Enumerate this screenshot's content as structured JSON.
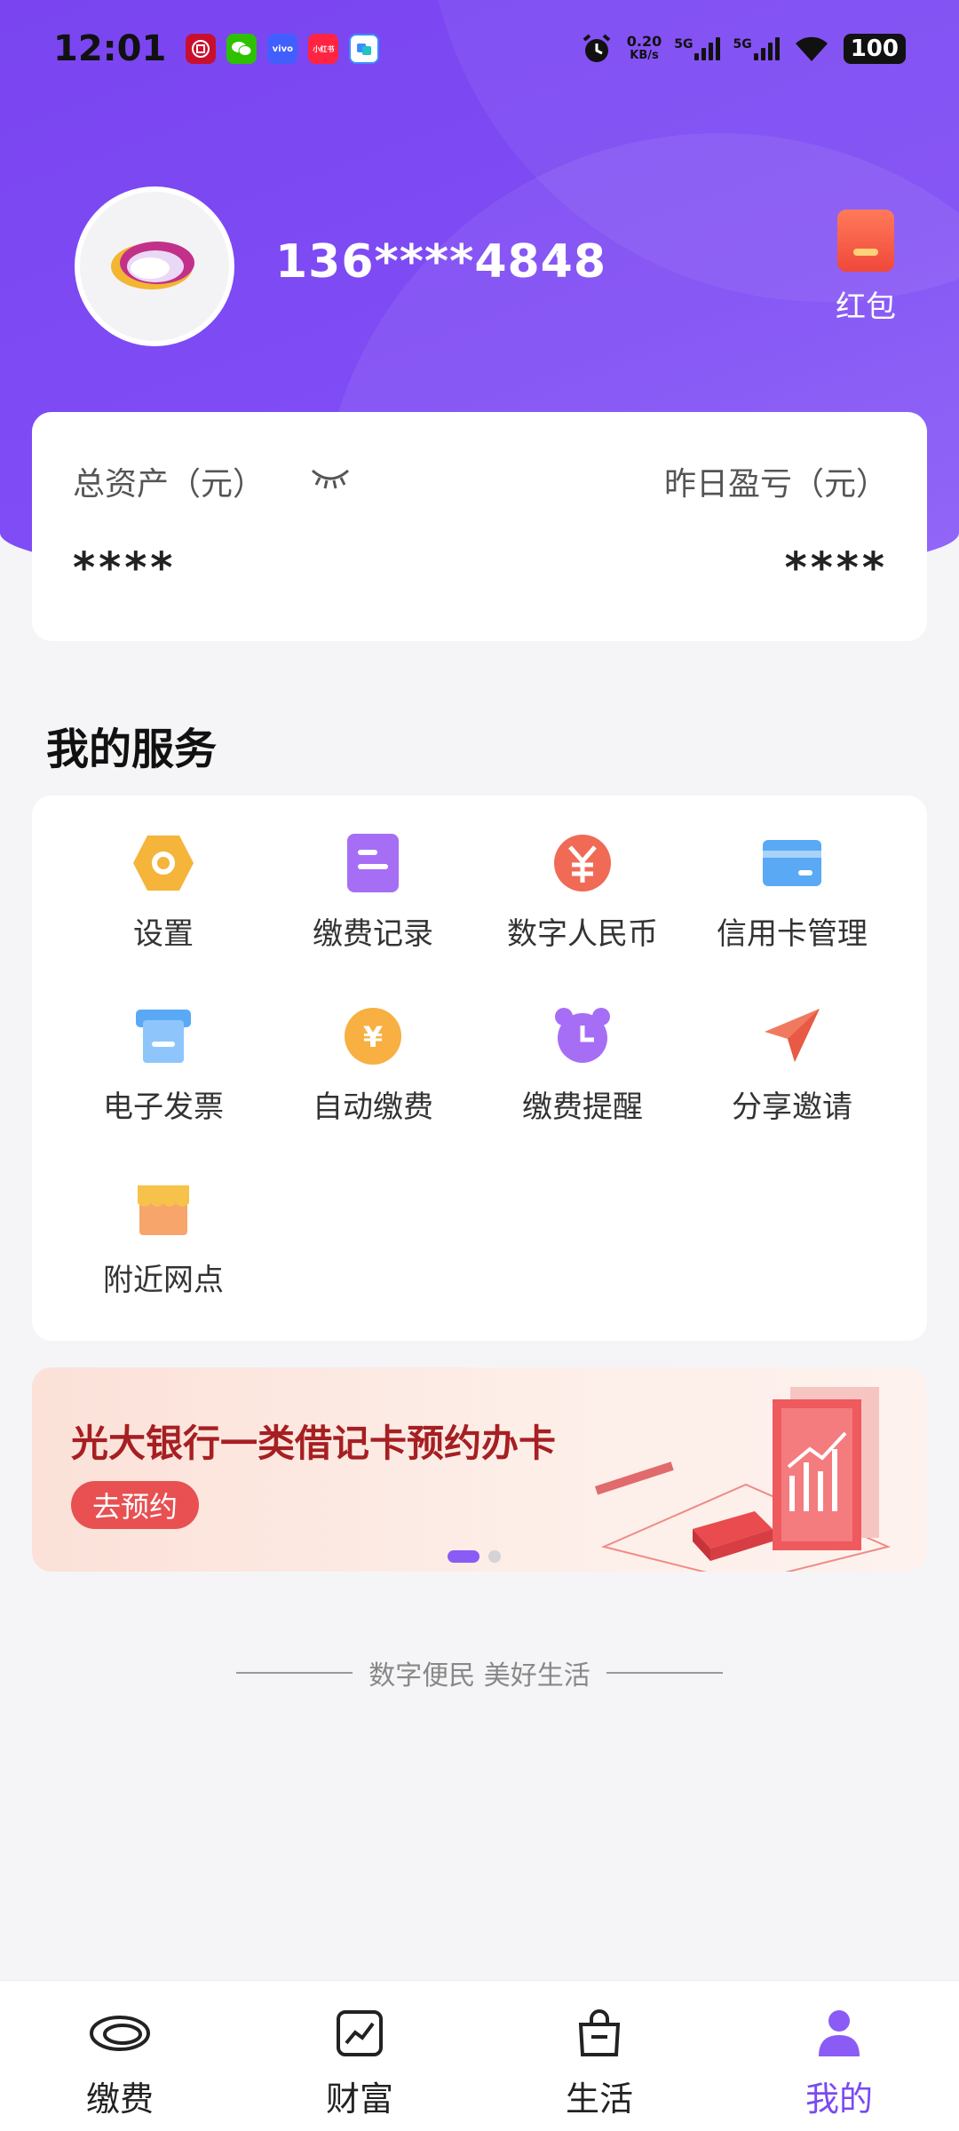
{
  "status_bar": {
    "time": "12:01",
    "net_speed_value": "0.20",
    "net_speed_unit": "KB/s",
    "sim1": "5G",
    "sim2": "5G",
    "battery": "100",
    "app_icons": [
      "bank-icon",
      "wechat-icon",
      "vivo-icon",
      "xiaohongshu-icon",
      "app-icon"
    ]
  },
  "profile": {
    "phone": "136****4848",
    "arrow": "›",
    "red_packet_label": "红包"
  },
  "assets": {
    "total_label": "总资产（元）",
    "total_value": "****",
    "yesterday_label": "昨日盈亏（元）",
    "yesterday_value": "****"
  },
  "services": {
    "title": "我的服务",
    "items": [
      {
        "label": "设置",
        "icon": "settings-hexagon-icon"
      },
      {
        "label": "缴费记录",
        "icon": "document-icon"
      },
      {
        "label": "数字人民币",
        "icon": "yuan-coin-icon"
      },
      {
        "label": "信用卡管理",
        "icon": "credit-card-icon"
      },
      {
        "label": "电子发票",
        "icon": "invoice-icon"
      },
      {
        "label": "自动缴费",
        "icon": "auto-pay-icon"
      },
      {
        "label": "缴费提醒",
        "icon": "alarm-clock-icon"
      },
      {
        "label": "分享邀请",
        "icon": "paper-plane-icon"
      },
      {
        "label": "附近网点",
        "icon": "store-icon"
      }
    ]
  },
  "banner": {
    "title": "光大银行一类借记卡预约办卡",
    "button": "去预约",
    "pages": 2,
    "active_page": 1
  },
  "slogan": "数字便民 美好生活",
  "bottom_nav": {
    "items": [
      {
        "label": "缴费",
        "icon": "cloud-icon",
        "active": false
      },
      {
        "label": "财富",
        "icon": "chart-icon",
        "active": false
      },
      {
        "label": "生活",
        "icon": "shopping-bag-icon",
        "active": false
      },
      {
        "label": "我的",
        "icon": "person-icon",
        "active": true
      }
    ]
  },
  "colors": {
    "header_purple": "#7a45f0",
    "accent_purple": "#7b4af2",
    "banner_red": "#a61f22",
    "banner_button": "#e85052"
  }
}
